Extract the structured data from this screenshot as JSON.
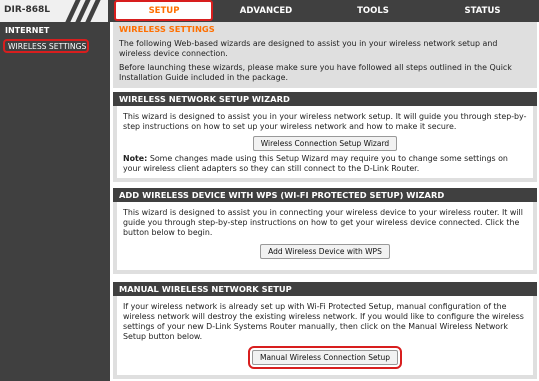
{
  "header": {
    "model": "DIR-868L",
    "tabs": [
      {
        "label": "SETUP"
      },
      {
        "label": "ADVANCED"
      },
      {
        "label": "TOOLS"
      },
      {
        "label": "STATUS"
      }
    ]
  },
  "sidebar": {
    "heading": "INTERNET",
    "items": [
      {
        "label": "WIRELESS SETTINGS"
      }
    ]
  },
  "intro": {
    "title": "WIRELESS SETTINGS",
    "p1": "The following Web-based wizards are designed to assist you in your wireless network setup and wireless device connection.",
    "p2": "Before launching these wizards, please make sure you have followed all steps outlined in the Quick Installation Guide included in the package."
  },
  "wizard": {
    "title": "WIRELESS NETWORK SETUP WIZARD",
    "text": "This wizard is designed to assist you in your wireless network setup. It will guide you through step-by-step instructions on how to set up your wireless network and how to make it secure.",
    "button": "Wireless Connection Setup Wizard",
    "note_label": "Note:",
    "note": " Some changes made using this Setup Wizard may require you to change some settings on your wireless client adapters so they can still connect to the D-Link Router."
  },
  "wps": {
    "title": "ADD WIRELESS DEVICE WITH WPS (WI-FI PROTECTED SETUP) WIZARD",
    "text": "This wizard is designed to assist you in connecting your wireless device to your wireless router. It will guide you through step-by-step instructions on how to get your wireless device connected. Click the button below to begin.",
    "button": "Add Wireless Device with WPS"
  },
  "manual": {
    "title": "MANUAL WIRELESS NETWORK SETUP",
    "text": "If your wireless network is already set up with Wi-Fi Protected Setup, manual configuration of the wireless network will destroy the existing wireless network. If you would like to configure the wireless settings of your new D-Link Systems Router manually, then click on the Manual Wireless Network Setup button below.",
    "button": "Manual Wireless Connection Setup"
  },
  "colors": {
    "accent": "#ff6f00",
    "highlight": "#d81e1e",
    "dark": "#404040"
  }
}
